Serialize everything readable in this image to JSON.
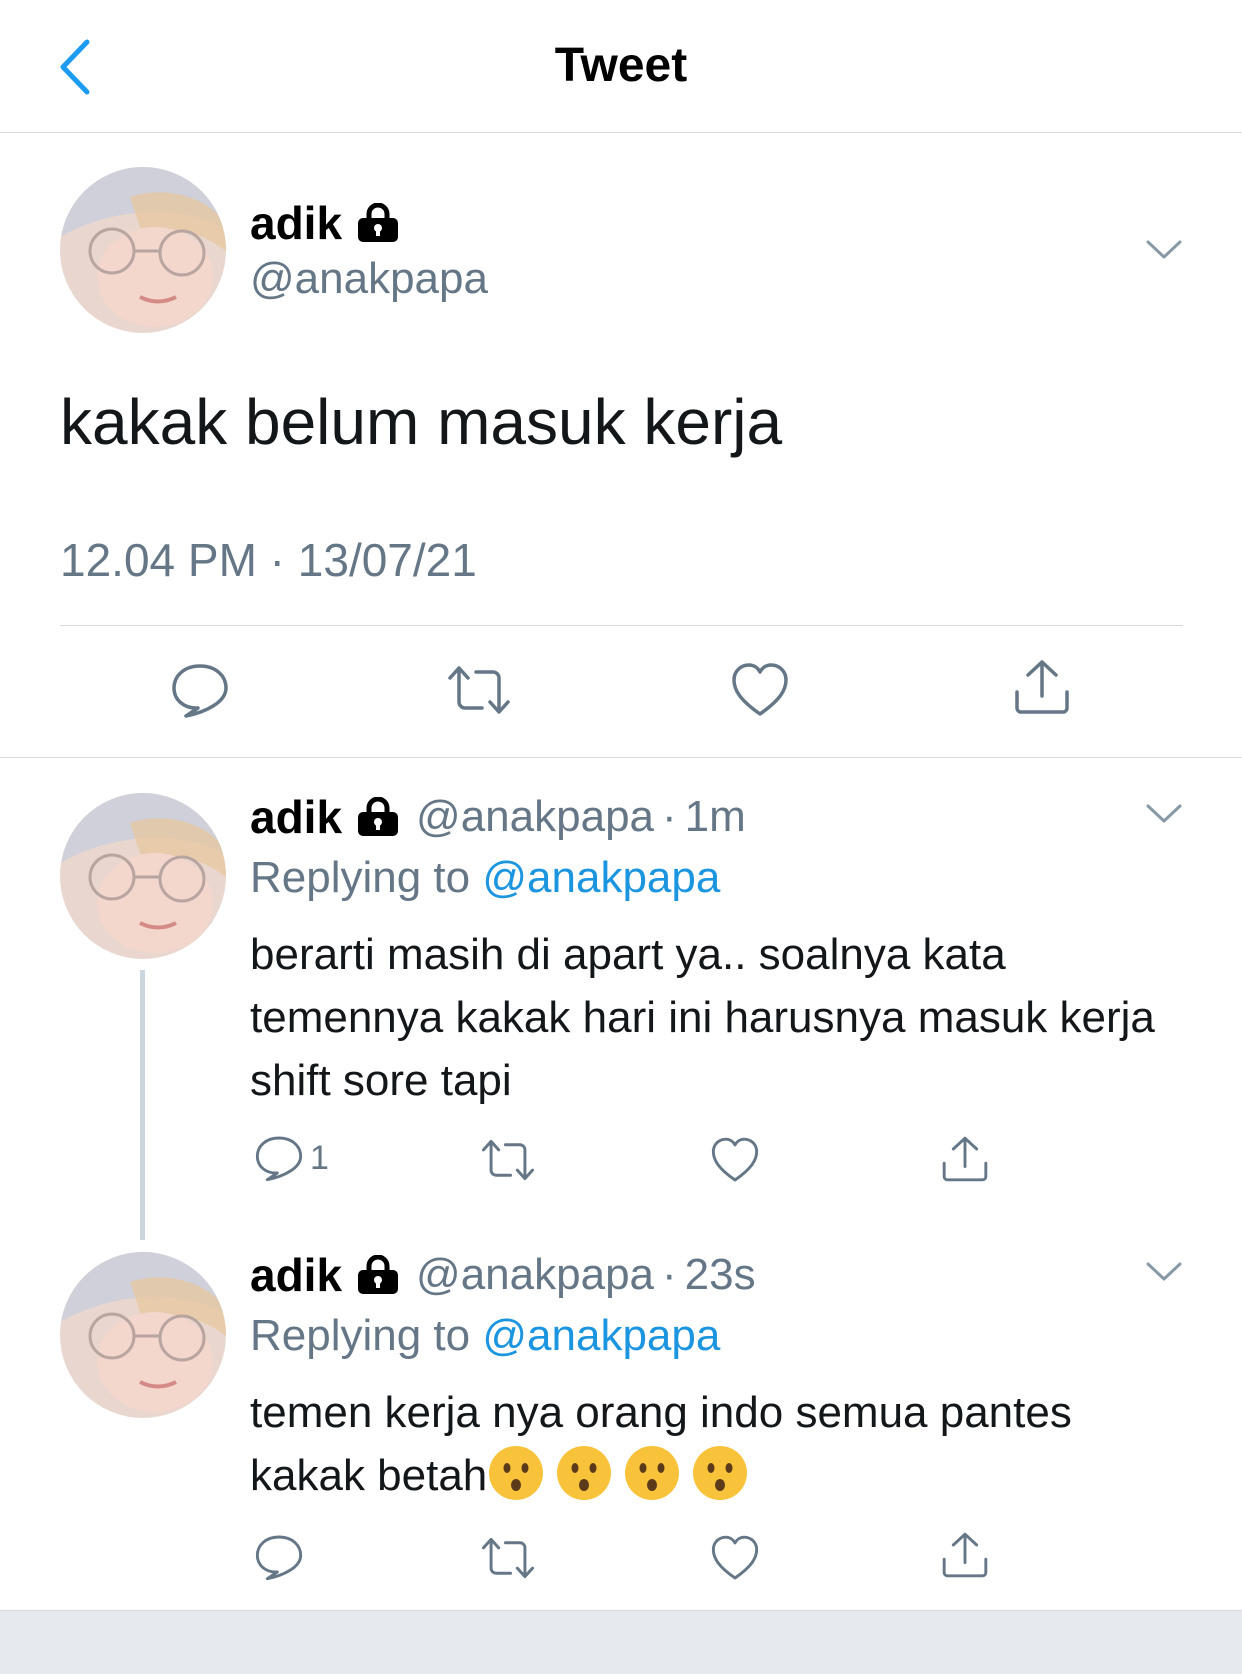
{
  "header": {
    "title": "Tweet",
    "back_icon": "chevron-left-icon"
  },
  "colors": {
    "accent": "#1d9bf0",
    "secondary_text": "#657786",
    "divider": "#d6dadd"
  },
  "main_tweet": {
    "display_name": "adik",
    "handle": "@anakpapa",
    "locked": true,
    "text": "kakak belum masuk kerja",
    "timestamp": "12.04 PM · 13/07/21"
  },
  "replies": [
    {
      "display_name": "adik",
      "handle": "@anakpapa",
      "separator": "·",
      "age": "1m",
      "replying_prefix": "Replying to",
      "replying_to": "@anakpapa",
      "text": "berarti masih di apart ya.. soalnya kata temennya kakak hari ini harusnya masuk kerja shift sore tapi",
      "reply_count": "1"
    },
    {
      "display_name": "adik",
      "handle": "@anakpapa",
      "separator": "·",
      "age": "23s",
      "replying_prefix": "Replying to",
      "replying_to": "@anakpapa",
      "text": "temen kerja nya orang indo semua pantes kakak betah",
      "emoji": [
        "hushed-face",
        "hushed-face",
        "hushed-face",
        "hushed-face"
      ]
    }
  ]
}
